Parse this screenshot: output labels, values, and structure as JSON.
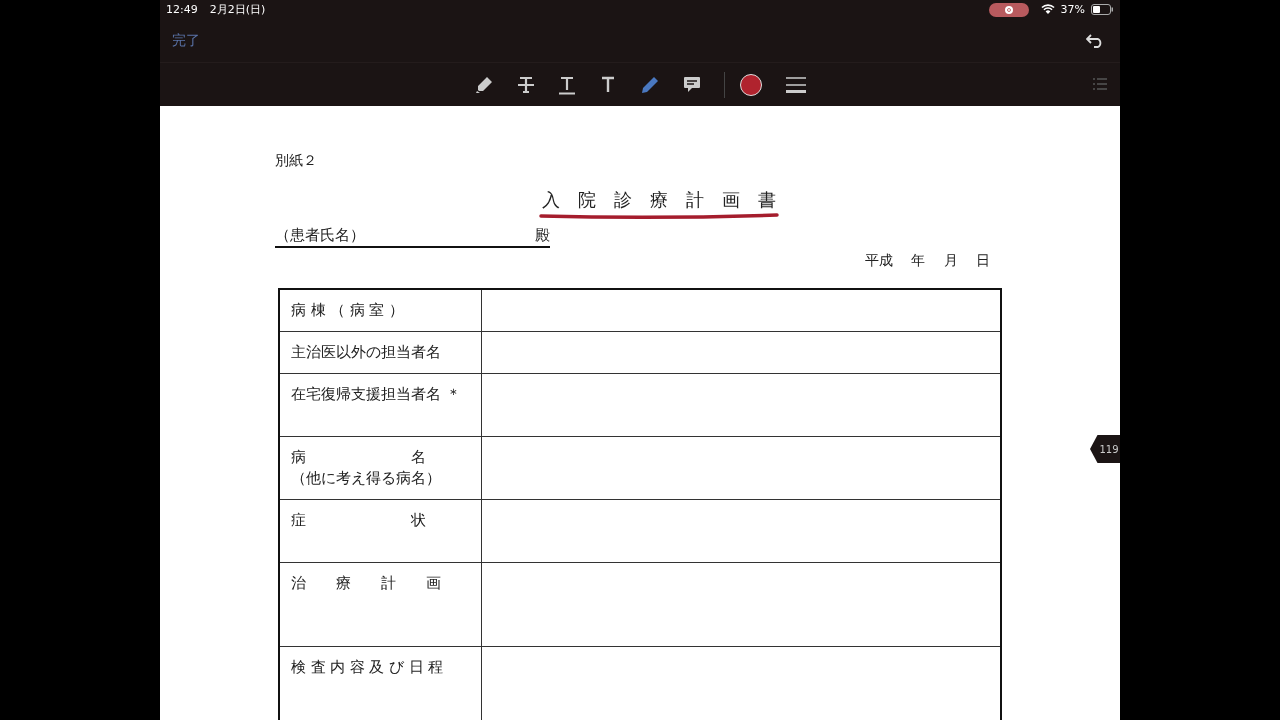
{
  "status_bar": {
    "time": "12:49",
    "date": "2月2日(日)",
    "battery": "37%"
  },
  "nav_bar": {
    "done": "完了"
  },
  "toolbar": {
    "tools": [
      {
        "kind": "highlighter"
      },
      {
        "kind": "strike"
      },
      {
        "kind": "underline"
      },
      {
        "kind": "text"
      },
      {
        "kind": "pen"
      },
      {
        "kind": "comment"
      },
      {
        "kind": "color",
        "color": "#b0232e"
      },
      {
        "kind": "lines"
      }
    ]
  },
  "page_badge": "119",
  "document": {
    "attachment": "別紙２",
    "title": "入　院　診　療　計　画　書",
    "patient_label": "（患者氏名）",
    "honorific": "殿",
    "date_line": "平成　 年　 月　 日",
    "rows": [
      {
        "label": [
          "病 棟 （ 病 室 ）"
        ]
      },
      {
        "label": [
          "主治医以外の担当者名"
        ]
      },
      {
        "label": [
          "在宅復帰支援担当者名 ＊"
        ]
      },
      {
        "label": [
          "病　　　　　　　名",
          "（他に考え得る病名）"
        ]
      },
      {
        "label": [
          "症　　　　　　　状"
        ]
      },
      {
        "label": [
          "治　　療　　計　　画"
        ]
      },
      {
        "label": [
          "検 査 内 容 及 び 日 程"
        ]
      }
    ]
  }
}
